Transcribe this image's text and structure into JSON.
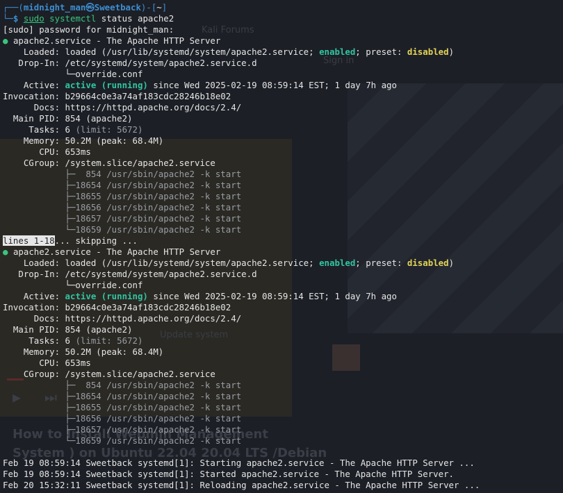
{
  "prompt": {
    "corner_top": "┌──(",
    "user": "midnight_man",
    "at": "㉿",
    "host": "Sweetback",
    "mid": ")-[",
    "cwd": "~",
    "close": "]",
    "corner_bottom": "└─",
    "dollar": "$",
    "cmd_sudo": "sudo",
    "cmd_systemctl": "systemctl",
    "cmd_args": " status apache2"
  },
  "sudo_prompt": "[sudo] password for midnight_man:",
  "status_blocks": [
    {
      "header": "apache2.service - The Apache HTTP Server",
      "loaded_prefix": "    Loaded: loaded (/usr/lib/systemd/system/apache2.service; ",
      "enabled": "enabled",
      "preset_text": "; preset: ",
      "disabled": "disabled",
      "loaded_suffix": ")",
      "dropin": "   Drop-In: /etc/systemd/system/apache2.service.d",
      "dropin_file": "            └─override.conf",
      "active_prefix": "    Active: ",
      "active_state": "active (running)",
      "active_suffix": " since Wed 2025-02-19 08:59:14 EST; 1 day 7h ago",
      "invocation": "Invocation: b29664c0e3a74af183cdc28246b18e02",
      "docs": "      Docs: https://httpd.apache.org/docs/2.4/",
      "main_pid": "  Main PID: 854 (apache2)",
      "tasks_prefix": "     Tasks: 6 ",
      "tasks_limit": "(limit: 5672)",
      "memory": "    Memory: 50.2M (peak: 68.4M)",
      "cpu": "       CPU: 653ms",
      "cgroup": "    CGroup: /system.slice/apache2.service",
      "processes": [
        "            ├─  854 /usr/sbin/apache2 -k start",
        "            ├─18654 /usr/sbin/apache2 -k start",
        "            ├─18655 /usr/sbin/apache2 -k start",
        "            ├─18656 /usr/sbin/apache2 -k start",
        "            ├─18657 /usr/sbin/apache2 -k start",
        "            └─18659 /usr/sbin/apache2 -k start"
      ]
    },
    {
      "header": "apache2.service - The Apache HTTP Server",
      "loaded_prefix": "    Loaded: loaded (/usr/lib/systemd/system/apache2.service; ",
      "enabled": "enabled",
      "preset_text": "; preset: ",
      "disabled": "disabled",
      "loaded_suffix": ")",
      "dropin": "   Drop-In: /etc/systemd/system/apache2.service.d",
      "dropin_file": "            └─override.conf",
      "active_prefix": "    Active: ",
      "active_state": "active (running)",
      "active_suffix": " since Wed 2025-02-19 08:59:14 EST; 1 day 7h ago",
      "invocation": "Invocation: b29664c0e3a74af183cdc28246b18e02",
      "docs": "      Docs: https://httpd.apache.org/docs/2.4/",
      "main_pid": "  Main PID: 854 (apache2)",
      "tasks_prefix": "     Tasks: 6 ",
      "tasks_limit": "(limit: 5672)",
      "memory": "    Memory: 50.2M (peak: 68.4M)",
      "cpu": "       CPU: 653ms",
      "cgroup": "    CGroup: /system.slice/apache2.service",
      "processes": [
        "            ├─  854 /usr/sbin/apache2 -k start",
        "            ├─18654 /usr/sbin/apache2 -k start",
        "            ├─18655 /usr/sbin/apache2 -k start",
        "            ├─18656 /usr/sbin/apache2 -k start",
        "            ├─18657 /usr/sbin/apache2 -k start",
        "            └─18659 /usr/sbin/apache2 -k start"
      ]
    }
  ],
  "pager": {
    "lines": "lines 1-18",
    "skipping": "... skipping ..."
  },
  "journal": [
    "Feb 19 08:59:14 Sweetback systemd[1]: Starting apache2.service - The Apache HTTP Server ...",
    "Feb 19 08:59:14 Sweetback systemd[1]: Started apache2.service - The Apache HTTP Server.",
    "Feb 20 15:32:11 Sweetback systemd[1]: Reloading apache2.service - The Apache HTTP Server ..."
  ],
  "background_ghost": {
    "kali_forums": "Kali Forums",
    "sign_in": "Sign in",
    "update_system": "Update system",
    "video_title_1": "How to Install Webmin Management",
    "video_title_2": "System ) on Ubuntu 22.04 20.04 LTS /Debian"
  },
  "colors": {
    "background": "#1c1f26",
    "text": "#e6e6e6",
    "prompt_blue": "#3e8ed0",
    "status_green": "#3ac47d",
    "active_teal": "#32c4a0",
    "disabled_yellow": "#e3d35a",
    "dim_gray": "#9a9da3"
  },
  "icons": {
    "status_dot": "●"
  }
}
